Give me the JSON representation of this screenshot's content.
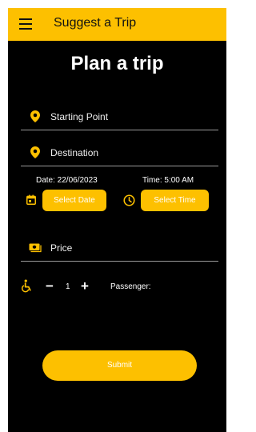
{
  "appbar": {
    "title": "Suggest a Trip",
    "menu_icon": "hamburger-menu-icon"
  },
  "page_title": "Plan a trip",
  "fields": {
    "starting_point": {
      "label": "Starting Point",
      "icon": "location-pin-icon"
    },
    "destination": {
      "label": "Destination",
      "icon": "location-pin-icon"
    },
    "price": {
      "label": "Price",
      "icon": "cash-icon"
    }
  },
  "date": {
    "label": "Date: 22/06/2023",
    "button": "Select Date",
    "icon": "calendar-icon"
  },
  "time": {
    "label": "Time: 5:00 AM",
    "button": "Select Time",
    "icon": "clock-icon"
  },
  "passengers": {
    "icon": "wheelchair-accessible-icon",
    "minus": "−",
    "value": "1",
    "plus": "+",
    "label": "Passenger:"
  },
  "submit_label": "Submit",
  "colors": {
    "accent": "#fdc000",
    "background": "#000000",
    "divider": "#9a9a9a"
  }
}
